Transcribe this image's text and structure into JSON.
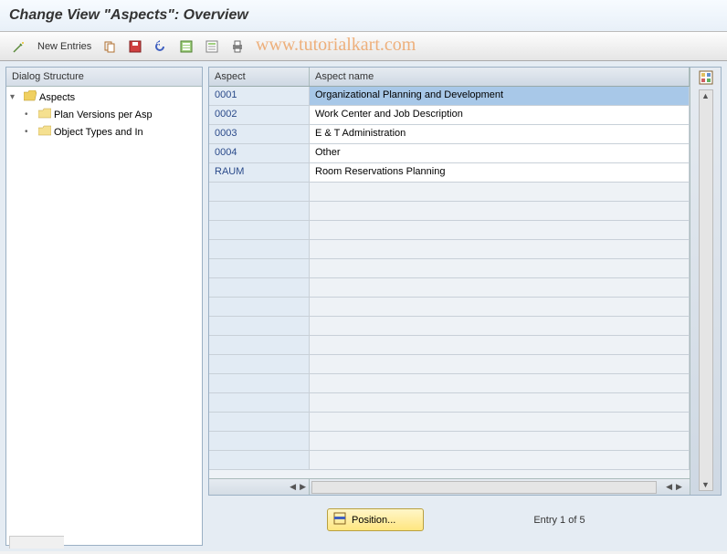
{
  "title": "Change View \"Aspects\": Overview",
  "toolbar": {
    "new_entries_label": "New Entries"
  },
  "tree": {
    "header": "Dialog Structure",
    "items": [
      {
        "label": "Aspects",
        "level": 0,
        "open": true,
        "expander": "▾"
      },
      {
        "label": "Plan Versions per Asp",
        "level": 1,
        "open": false,
        "expander": "•"
      },
      {
        "label": "Object Types and In",
        "level": 1,
        "open": false,
        "expander": "•"
      }
    ]
  },
  "grid": {
    "columns": {
      "aspect": "Aspect",
      "name": "Aspect name"
    },
    "rows": [
      {
        "aspect": "0001",
        "name": "Organizational Planning and Development",
        "selected": true
      },
      {
        "aspect": "0002",
        "name": "Work Center and Job Description",
        "selected": false
      },
      {
        "aspect": "0003",
        "name": "E & T Administration",
        "selected": false
      },
      {
        "aspect": "0004",
        "name": "Other",
        "selected": false
      },
      {
        "aspect": "RAUM",
        "name": "Room Reservations Planning",
        "selected": false
      }
    ],
    "empty_rows": 15
  },
  "footer": {
    "position_label": "Position...",
    "entry_text": "Entry 1 of 5"
  },
  "watermark": "www.tutorialkart.com"
}
